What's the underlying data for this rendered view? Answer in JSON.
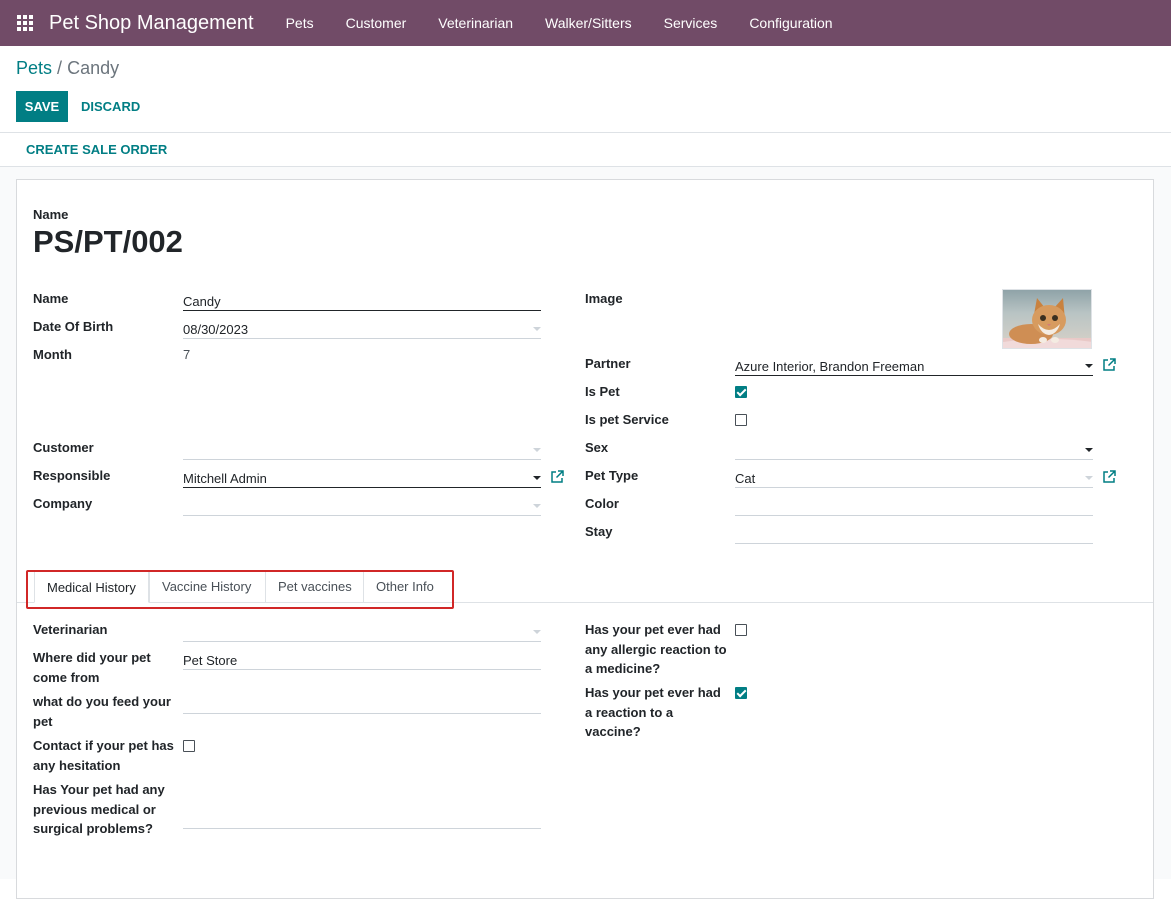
{
  "navbar": {
    "brand": "Pet Shop Management",
    "menu": [
      "Pets",
      "Customer",
      "Veterinarian",
      "Walker/Sitters",
      "Services",
      "Configuration"
    ]
  },
  "breadcrumb": {
    "parent": "Pets",
    "separator": "/",
    "current": "Candy"
  },
  "actions": {
    "save": "SAVE",
    "discard": "DISCARD",
    "create_sale_order": "CREATE SALE ORDER"
  },
  "header": {
    "name_label": "Name",
    "record_name": "PS/PT/002"
  },
  "left": {
    "name_label": "Name",
    "name_value": "Candy",
    "dob_label": "Date Of Birth",
    "dob_value": "08/30/2023",
    "month_label": "Month",
    "month_value": "7",
    "customer_label": "Customer",
    "customer_value": "",
    "responsible_label": "Responsible",
    "responsible_value": "Mitchell Admin",
    "company_label": "Company",
    "company_value": ""
  },
  "right": {
    "image_label": "Image",
    "partner_label": "Partner",
    "partner_value": "Azure Interior, Brandon Freeman",
    "is_pet_label": "Is Pet",
    "is_pet": true,
    "is_pet_service_label": "Is pet Service",
    "is_pet_service": false,
    "sex_label": "Sex",
    "sex_value": "",
    "pet_type_label": "Pet Type",
    "pet_type_value": "Cat",
    "color_label": "Color",
    "color_value": "",
    "stay_label": "Stay",
    "stay_value": ""
  },
  "tabs": [
    "Medical History",
    "Vaccine History",
    "Pet vaccines",
    "Other Info"
  ],
  "medical": {
    "vet_label": "Veterinarian",
    "vet_value": "",
    "where_label_1": "Where did your pet",
    "where_label_2": "come from",
    "where_value": "Pet Store",
    "feed_label_1": "what do you feed your",
    "feed_label_2": "pet",
    "feed_value": "",
    "contact_label_1": "Contact if your pet has",
    "contact_label_2": "any hesitation",
    "contact_checked": false,
    "prev_label_1": "Has Your pet had any",
    "prev_label_2": "previous medical or",
    "prev_label_3": "surgical problems?",
    "prev_value": "",
    "allergic_label_1": "Has your pet ever had",
    "allergic_label_2": "any allergic reaction to",
    "allergic_label_3": "a medicine?",
    "allergic_checked": false,
    "vaccine_label_1": "Has your pet ever had",
    "vaccine_label_2": "a reaction to a",
    "vaccine_label_3": "vaccine?",
    "vaccine_checked": true
  },
  "colors": {
    "navbar": "#714b67",
    "primary": "#017e84",
    "highlight": "#d12727"
  },
  "icons": {
    "apps": "apps-grid-icon",
    "external": "external-link-icon"
  }
}
